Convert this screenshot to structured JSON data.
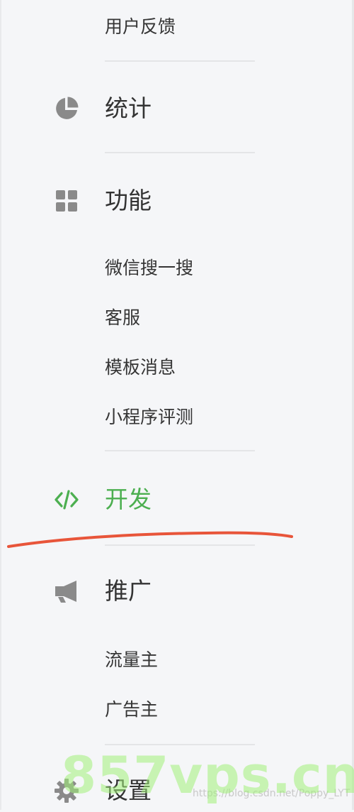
{
  "colors": {
    "active": "#4caf50",
    "icon": "#8a8a8a",
    "annotation_stroke": "#e8553a"
  },
  "sections": [
    {
      "label": "统计",
      "icon": "pie-chart-icon"
    },
    {
      "label": "功能",
      "icon": "grid-icon"
    },
    {
      "label": "开发",
      "icon": "code-icon",
      "active": true
    },
    {
      "label": "推广",
      "icon": "megaphone-icon"
    },
    {
      "label": "设置",
      "icon": "gear-icon"
    }
  ],
  "submenus": {
    "top": [
      "用户反馈"
    ],
    "gongneng": [
      "微信搜一搜",
      "客服",
      "模板消息",
      "小程序评测"
    ],
    "tuiguang": [
      "流量主",
      "广告主"
    ]
  },
  "watermark": {
    "text": "https://blog.csdn.net/Poppy_LYT",
    "brand": "857vps.cn"
  }
}
